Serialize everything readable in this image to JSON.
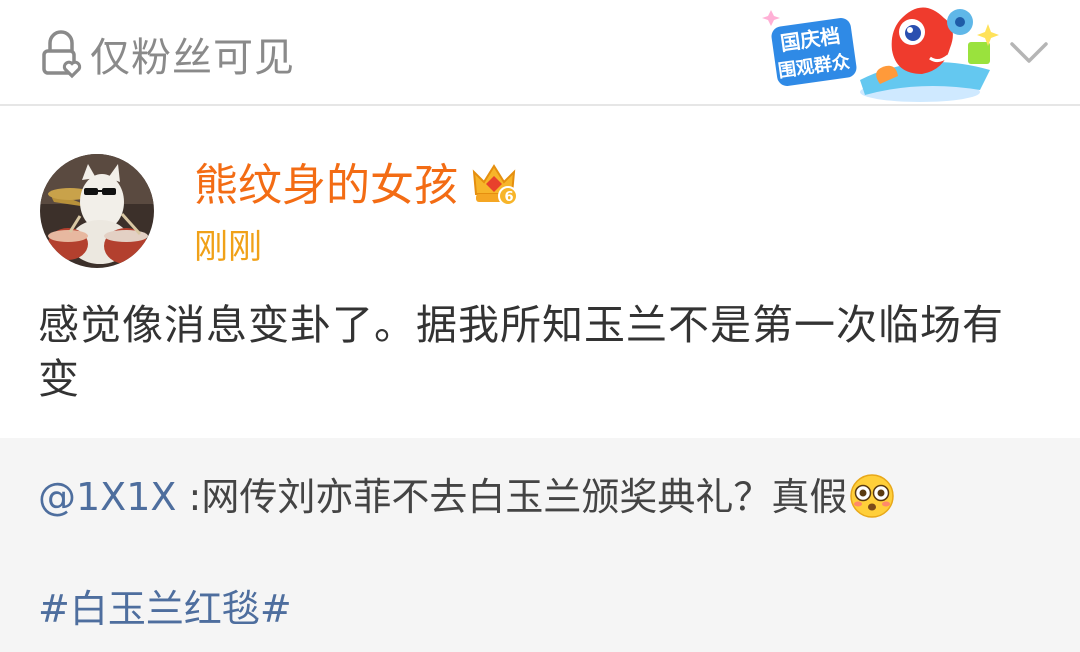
{
  "header": {
    "visibility_label": "仅粉丝可见",
    "badge_text_line1": "国庆档",
    "badge_text_line2": "围观群众"
  },
  "post": {
    "author": "熊纹身的女孩",
    "crown_level": "6",
    "timestamp": "刚刚",
    "text": "感觉像消息变卦了。据我所知玉兰不是第一次临场有变"
  },
  "quoted": {
    "mention": "@1X1X",
    "separator": " :",
    "text": "网传刘亦菲不去白玉兰颁奖典礼？真假",
    "emoji": "flushed-face",
    "hashtag": "#白玉兰红毯#"
  },
  "colors": {
    "author": "#f36c14",
    "timestamp": "#f0a118",
    "link": "#4e6e9e",
    "quote_bg": "#f5f5f5"
  }
}
